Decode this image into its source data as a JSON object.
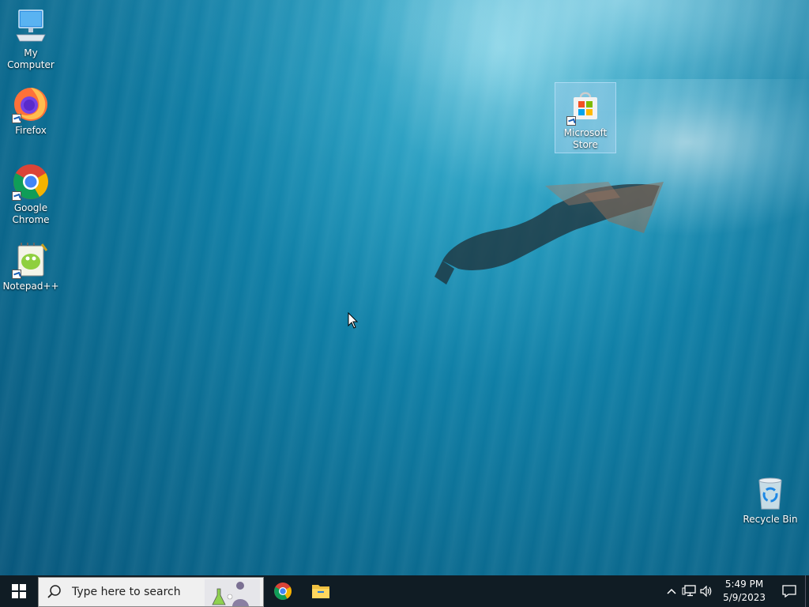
{
  "desktop": {
    "icons": [
      {
        "label": "My Computer"
      },
      {
        "label": "Firefox"
      },
      {
        "label": "Google Chrome"
      },
      {
        "label": "Notepad++"
      },
      {
        "label": "Microsoft Store"
      },
      {
        "label": "Recycle Bin"
      }
    ]
  },
  "taskbar": {
    "search_placeholder": "Type here to search",
    "pinned": [
      "chrome-icon",
      "file-explorer-icon"
    ],
    "clock": {
      "time": "5:49 PM",
      "date": "5/9/2023"
    }
  },
  "colors": {
    "taskbar": "#101c24",
    "windows_blue": "#0078d7",
    "chrome_red": "#db4437",
    "chrome_green": "#0f9d58",
    "chrome_yellow": "#f4b400",
    "chrome_blue": "#4285f4"
  }
}
